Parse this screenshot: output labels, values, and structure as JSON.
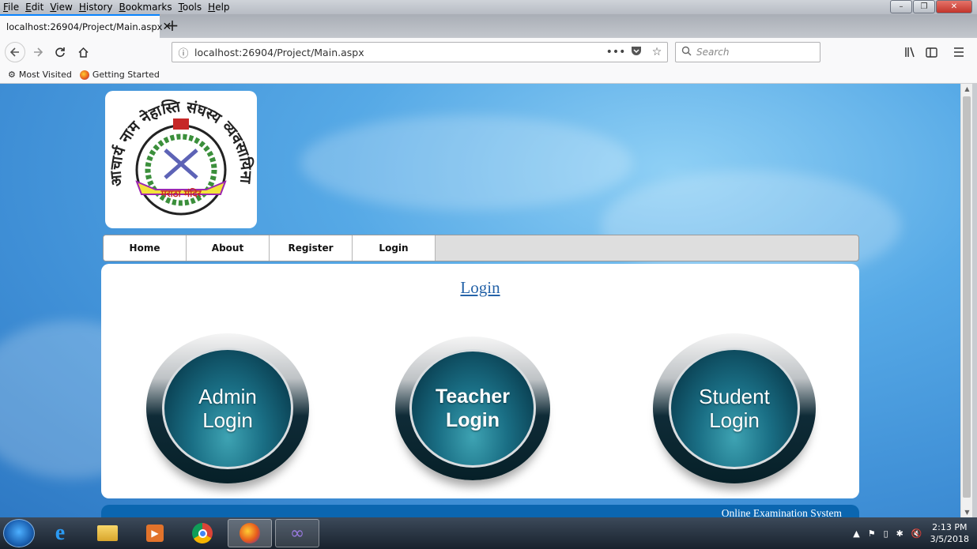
{
  "menubar": {
    "items": [
      "File",
      "Edit",
      "View",
      "History",
      "Bookmarks",
      "Tools",
      "Help"
    ]
  },
  "window_controls": {
    "minimize": "–",
    "restore": "❐",
    "close": "✕"
  },
  "tab": {
    "title": "localhost:26904/Project/Main.aspx",
    "close": "✕"
  },
  "new_tab": "+",
  "address": {
    "url": "localhost:26904/Project/Main.aspx",
    "more": "•••"
  },
  "search": {
    "placeholder": "Search"
  },
  "bookmarks": {
    "items": [
      "Most Visited",
      "Getting Started"
    ]
  },
  "site": {
    "logo_emblem_text": "मराठा मंदिर",
    "logo_arc_text": "आचार्य नाम नेहास्ति संघस्य व्यवसायिनाम्",
    "nav": [
      "Home",
      "About",
      "Register",
      "Login"
    ],
    "heading": "Login",
    "buttons": [
      {
        "line1": "Admin",
        "line2": "Login"
      },
      {
        "line1": "Teacher",
        "line2": "Login"
      },
      {
        "line1": "Student",
        "line2": "Login"
      }
    ],
    "footer": "Online Examination System"
  },
  "taskbar": {
    "time": "2:13 PM",
    "date": "3/5/2018"
  },
  "colors": {
    "accent": "#0a84ff",
    "link": "#2563a8",
    "footer": "#0b66b0",
    "orb": "#1a6f85"
  }
}
